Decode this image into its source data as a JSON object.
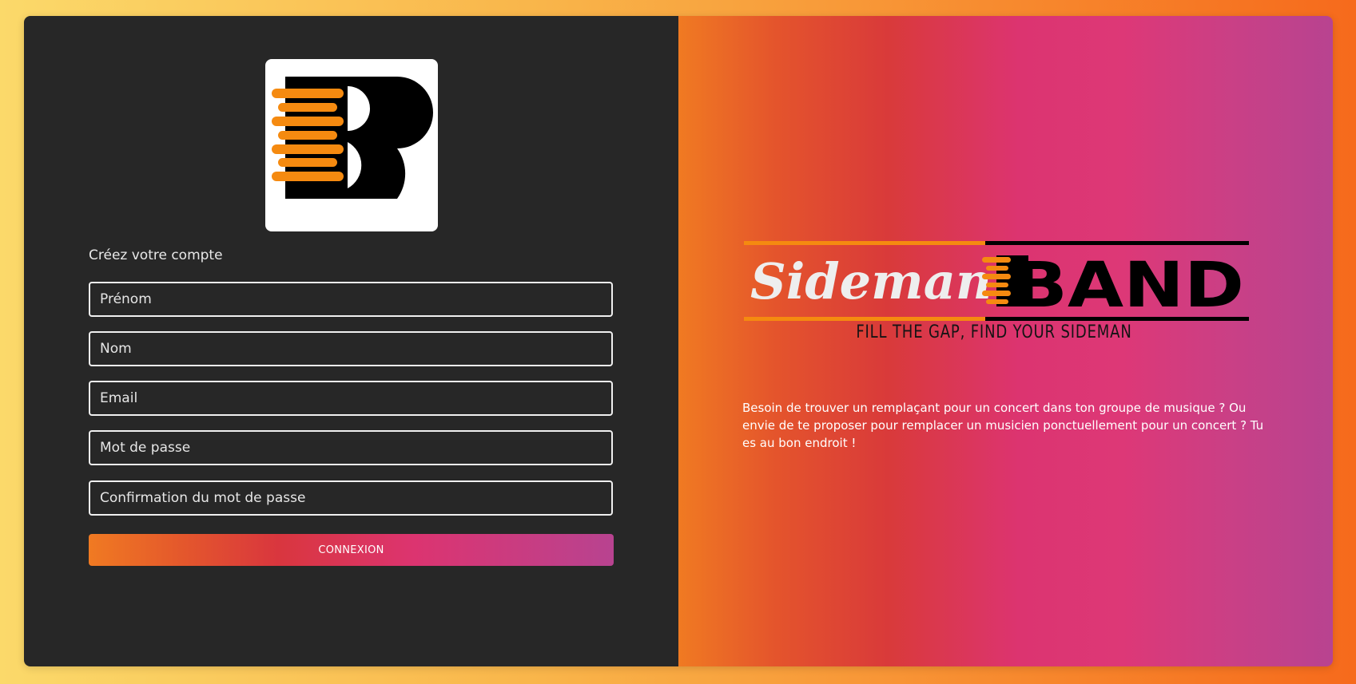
{
  "form": {
    "heading": "Créez votre compte",
    "fields": {
      "first_name_placeholder": "Prénom",
      "last_name_placeholder": "Nom",
      "email_placeholder": "Email",
      "password_placeholder": "Mot de passe",
      "password_confirm_placeholder": "Confirmation du mot de passe"
    },
    "submit_label": "CONNEXION"
  },
  "brand": {
    "script_word": "Sideman",
    "block_word": "BAND",
    "tagline": "FILL THE GAP, FIND YOUR SIDEMAN",
    "description": "Besoin de trouver un remplaçant pour un concert dans ton groupe de musique ? Ou envie de te proposer pour remplacer un musicien ponctuellement pour un concert ? Tu es au bon endroit !"
  },
  "colors": {
    "accent_orange": "#f58a10",
    "panel_dark": "#272727"
  }
}
